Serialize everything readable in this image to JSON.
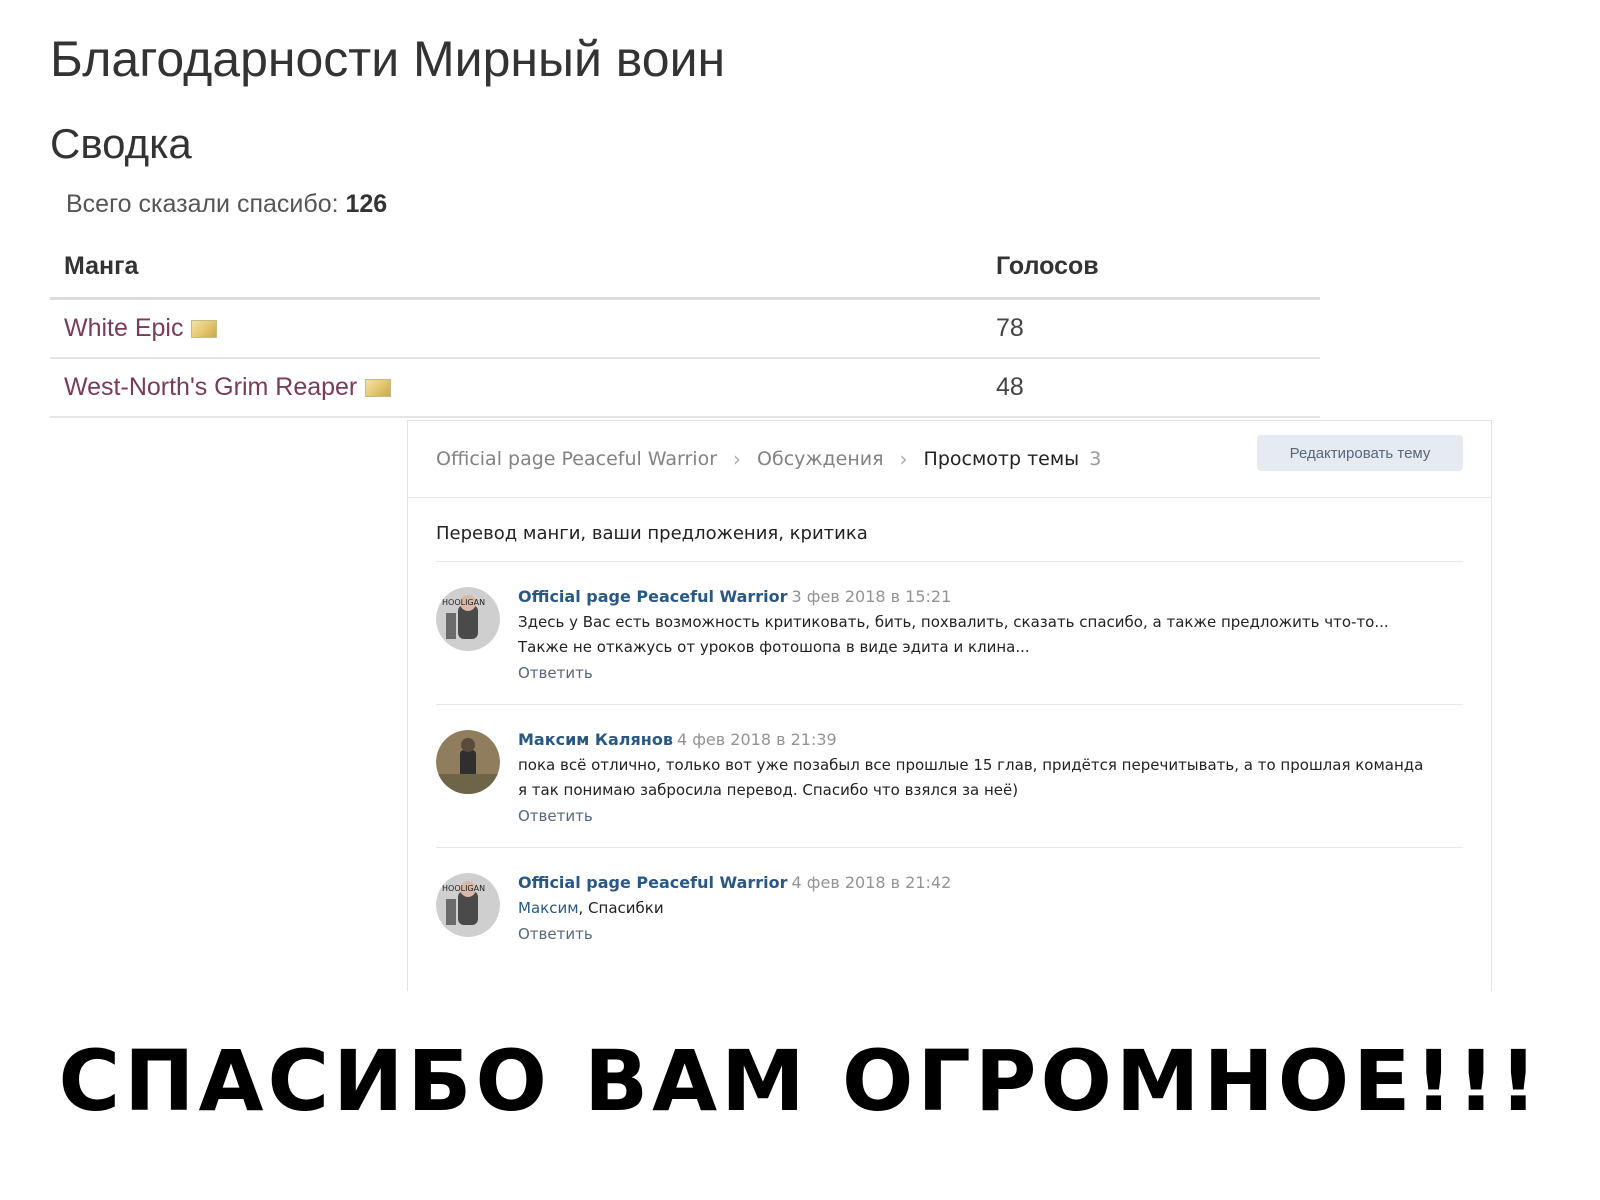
{
  "page_title": "Благодарности Мирный воин",
  "summary": {
    "title": "Сводка",
    "total_label": "Всего сказали спасибо:",
    "total_value": "126"
  },
  "table": {
    "headers": [
      "Манга",
      "Голосов"
    ],
    "rows": [
      {
        "title": "White Epic",
        "votes": "78",
        "icon": "flag-icon"
      },
      {
        "title": "West-North's Grim Reaper",
        "votes": "48",
        "icon": "flag-icon"
      }
    ]
  },
  "discussion": {
    "breadcrumbs": [
      "Official page Peaceful Warrior",
      "Обсуждения",
      "Просмотр темы"
    ],
    "crumb_count": "3",
    "edit_button": "Редактировать тему",
    "topic_title": "Перевод манги, ваши предложения, критика",
    "posts": [
      {
        "author": "Official page Peaceful Warrior",
        "date": "3 фев 2018 в 15:21",
        "lines": [
          "Здесь у Вас есть возможность критиковать, бить, похвалить, сказать спасибо, а также предложить что-то...",
          "Также не откажусь от уроков фотошопа в виде эдита и клина..."
        ],
        "reply": "Ответить"
      },
      {
        "author": "Максим Калянов",
        "date": "4 фев 2018 в 21:39",
        "lines": [
          "пока всё отлично, только вот уже позабыл все прошлые 15 глав, придётся перечитывать, а то прошлая команда",
          "я так понимаю забросила перевод. Спасибо что взялся за неё)"
        ],
        "reply": "Ответить"
      },
      {
        "author": "Official page Peaceful Warrior",
        "date": "4 фев 2018 в 21:42",
        "mention": "Максим",
        "text": ", Спасибки",
        "reply": "Ответить"
      }
    ]
  },
  "caption": "СПАСИБО ВАМ ОГРОМНОЕ!!!",
  "colors": {
    "link": "#7a3b5b",
    "vk_author": "#2a5885",
    "vk_button_bg": "#e5ebf1"
  }
}
